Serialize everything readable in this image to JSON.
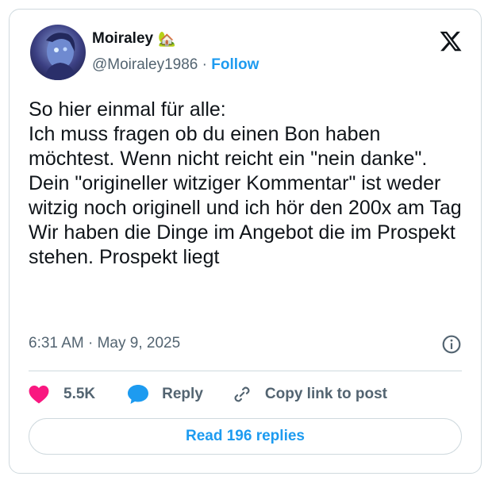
{
  "author": {
    "name": "Moiraley",
    "emoji": "🏡",
    "handle": "@Moiraley1986",
    "separator": "·",
    "follow_label": "Follow"
  },
  "tweet": {
    "text": "So hier einmal für alle:\nIch muss fragen ob du einen Bon haben möchtest. Wenn nicht reicht ein \"nein danke\". Dein \"origineller witziger Kommentar\" ist weder witzig noch originell und ich hör den 200x am Tag\nWir haben die Dinge im Angebot die im Prospekt stehen. Prospekt liegt",
    "timestamp": "6:31 AM · May 9, 2025"
  },
  "actions": {
    "like_count": "5.5K",
    "reply_label": "Reply",
    "copy_link_label": "Copy link to post"
  },
  "read_replies_label": "Read 196 replies",
  "colors": {
    "accent": "#1d9bf0",
    "like": "#f91880",
    "text": "#0f1419",
    "muted": "#536471",
    "border": "#cfd9de"
  },
  "icons": [
    "x-logo-icon",
    "info-icon",
    "heart-icon",
    "reply-bubble-icon",
    "link-icon"
  ]
}
